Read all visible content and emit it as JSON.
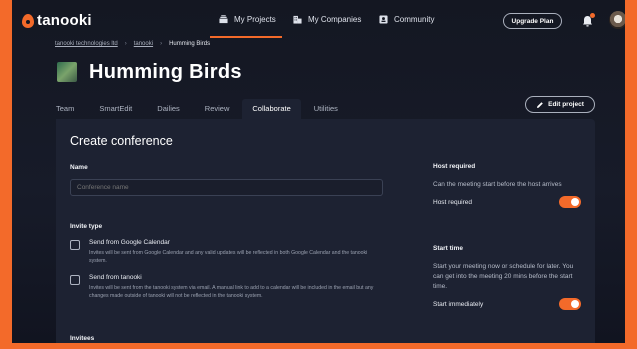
{
  "brand": {
    "name": "tanooki"
  },
  "nav": {
    "items": [
      {
        "label": "My Projects",
        "icon": "projects-icon"
      },
      {
        "label": "My Companies",
        "icon": "building-icon"
      },
      {
        "label": "Community",
        "icon": "community-icon"
      }
    ],
    "upgrade_label": "Upgrade Plan"
  },
  "breadcrumb": [
    "tanooki technologies ltd",
    "tanooki",
    "Humming Birds"
  ],
  "project": {
    "title": "Humming Birds"
  },
  "tabs": [
    "Team",
    "SmartEdit",
    "Dailies",
    "Review",
    "Collaborate",
    "Utilities"
  ],
  "active_tab": "Collaborate",
  "edit_label": "Edit project",
  "form": {
    "heading": "Create conference",
    "name_label": "Name",
    "name_placeholder": "Conference name",
    "invite_label": "Invite type",
    "options": [
      {
        "title": "Send from Google Calendar",
        "desc": "Invites will be sent from Google Calendar and any valid updates will be reflected in both Google Calendar and the tanooki system."
      },
      {
        "title": "Send from tanooki",
        "desc": "Invites will be sent from the tanooki system via email. A manual link to add to a calendar will be included in the email but any changes made outside of tanooki will not be reflected in the tanooki system."
      }
    ],
    "invitees_label": "Invitees"
  },
  "side": {
    "host_heading": "Host required",
    "host_text": "Can the meeting start before the host arrives",
    "host_toggle_label": "Host required",
    "host_toggle_on": true,
    "start_heading": "Start time",
    "start_text": "Start your meeting now or schedule for later. You can get into the meeting 20 mins before the start time.",
    "start_toggle_label": "Start immediately",
    "start_toggle_on": true
  },
  "colors": {
    "accent": "#f36a2a",
    "background": "#141722",
    "card": "#1d2232"
  }
}
